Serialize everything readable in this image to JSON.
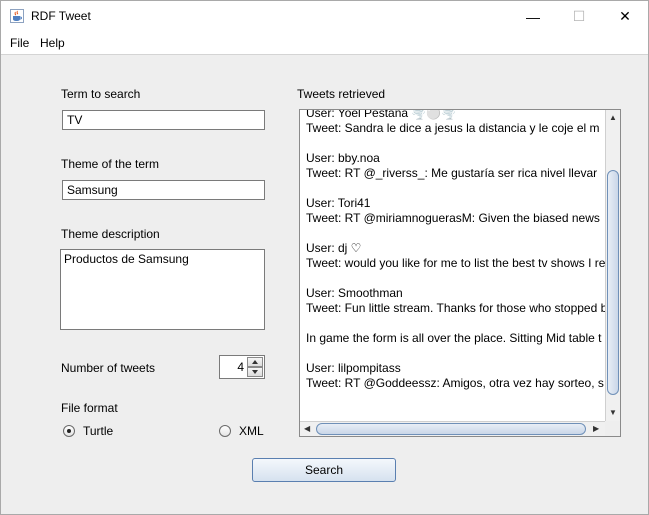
{
  "window": {
    "title": "RDF Tweet",
    "controls": {
      "minimize": "—",
      "maximize": "☐",
      "close": "✕"
    }
  },
  "menu": {
    "file": "File",
    "help": "Help"
  },
  "form": {
    "term_label": "Term to search",
    "term_value": "TV",
    "theme_label": "Theme of the term",
    "theme_value": "Samsung",
    "description_label": "Theme description",
    "description_value": "Productos de Samsung",
    "num_tweets_label": "Number of tweets",
    "num_tweets_value": "4",
    "format_label": "File format",
    "format_turtle": "Turtle",
    "format_xml": "XML",
    "selected_format": "Turtle"
  },
  "tweets": {
    "label": "Tweets retrieved",
    "lines": [
      "User: Yoel Pestana 🌪️⚪🌪️",
      "Tweet: Sandra le dice a jesus la distancia y le coje el m",
      "",
      "User: bby.noa",
      "Tweet: RT @_riverss_: Me gustaría ser rica nivel llevar",
      "",
      "User: Tori41",
      "Tweet: RT @miriamnoguerasM: Given the biased news",
      "",
      "User: dj ♡",
      "Tweet: would you like for me to list the best tv shows I re",
      "",
      "User: Smoothman",
      "Tweet: Fun little stream. Thanks for those who stopped b",
      "",
      "In game the form is all over the place. Sitting Mid table t",
      "",
      "User: lilpompitass",
      "Tweet: RT @Goddeessz: Amigos, otra vez hay sorteo, s"
    ]
  },
  "actions": {
    "search_label": "Search"
  },
  "colors": {
    "accent": "#5a7fb0",
    "background": "#eeeeee"
  }
}
